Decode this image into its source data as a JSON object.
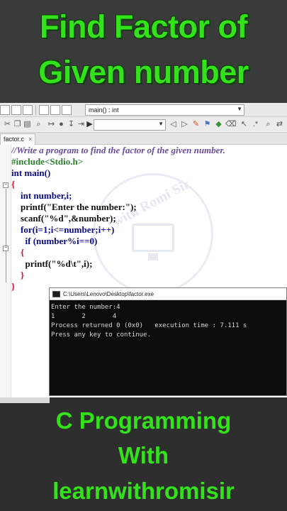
{
  "title": {
    "line1": "Find Factor of",
    "line2": "Given number"
  },
  "ide": {
    "function_selector": "main() : int",
    "tab_label": "factor.c",
    "tab_close": "×"
  },
  "code_lines": [
    "//Write a program to find the factor of the given number.",
    "#include<Stdio.h>",
    "int main()",
    "{",
    "    int number,i;",
    "    printf(\"Enter the number:\");",
    "    scanf(\"%d\",&number);",
    "    for(i=1;i<=number;i++)",
    "      if (number%i==0)",
    "    {",
    "      printf(\"%d\\t\",i);",
    "    }",
    "}"
  ],
  "watermark": "with Romi Sir",
  "console": {
    "title": "C:\\Users\\Lenovo\\Desktop\\factor.exe",
    "lines": [
      "Enter the number:4",
      "1       2       4",
      "Process returned 0 (0x0)   execution time : 7.111 s",
      "Press any key to continue."
    ]
  },
  "footer": {
    "line1": "C Programming",
    "line2": "With",
    "line3": "learnwithromisir"
  },
  "colors": {
    "title_green": "#34e21b",
    "comment": "#6b4b9c",
    "preprocessor": "#2d7f2d",
    "keyword": "#0b0b8c",
    "string": "#0000ff",
    "bracket_red": "#c8102e"
  }
}
